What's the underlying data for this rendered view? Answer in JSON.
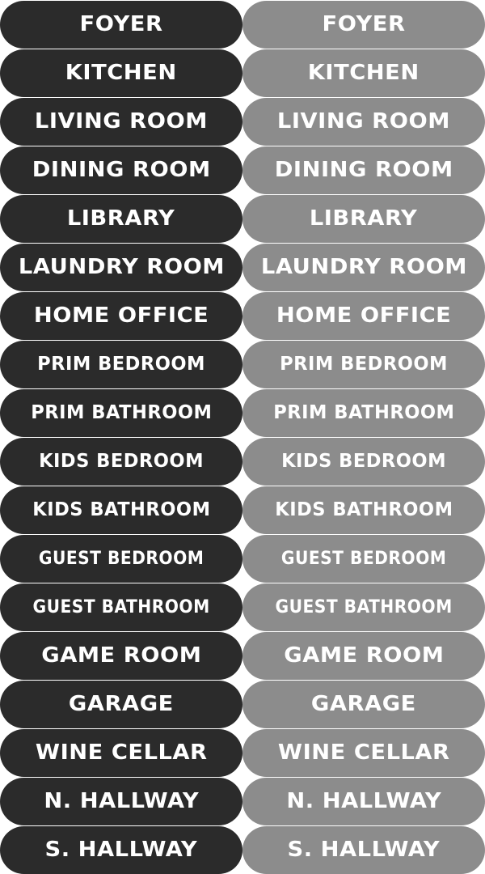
{
  "colors": {
    "dark_label": "#2b2b2b",
    "grey_label": "#8c8c8c",
    "text": "#ffffff",
    "background": "#ffffff"
  },
  "labels": [
    "FOYER",
    "KITCHEN",
    "LIVING ROOM",
    "DINING ROOM",
    "LIBRARY",
    "LAUNDRY ROOM",
    "HOME OFFICE",
    "PRIM BEDROOM",
    "PRIM BATHROOM",
    "KIDS BEDROOM",
    "KIDS BATHROOM",
    "GUEST BEDROOM",
    "GUEST BATHROOM",
    "GAME ROOM",
    "GARAGE",
    "WINE CELLAR",
    "N. HALLWAY",
    "S. HALLWAY"
  ]
}
